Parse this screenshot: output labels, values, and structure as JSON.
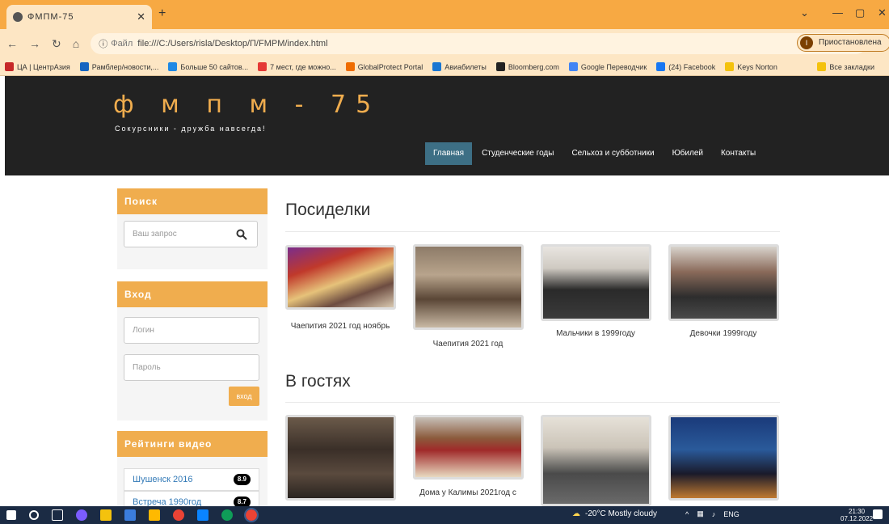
{
  "browser": {
    "tab_title": "ФМПМ-75",
    "url_label": "Файл",
    "url": "file:///C:/Users/risla/Desktop/П/FMPM/index.html",
    "profile_status": "Приостановлена",
    "profile_initial": "I",
    "bookmarks": [
      {
        "label": "ЦА | ЦентрАзия",
        "color": "#c62828"
      },
      {
        "label": "Рамблер/новости,...",
        "color": "#1565c0"
      },
      {
        "label": "Больше 50 сайтов...",
        "color": "#1e88e5"
      },
      {
        "label": "7 мест, где можно...",
        "color": "#e53935"
      },
      {
        "label": "GlobalProtect Portal",
        "color": "#ef6c00"
      },
      {
        "label": "Авиабилеты",
        "color": "#1976d2"
      },
      {
        "label": "Bloomberg.com",
        "color": "#222222"
      },
      {
        "label": "Google Переводчик",
        "color": "#4285f4"
      },
      {
        "label": "(24) Facebook",
        "color": "#1877f2"
      },
      {
        "label": "Keys Norton",
        "color": "#f4c20d"
      }
    ],
    "more_bookmarks": "Все закладки"
  },
  "site": {
    "logo": "ф м п м - 75",
    "slogan": "Сокурсники - дружба навсегда!",
    "menu": [
      "Главная",
      "Студенческие годы",
      "Сельхоз и субботники",
      "Юбилей",
      "Контакты"
    ]
  },
  "sidebar": {
    "search_title": "Поиск",
    "search_placeholder": "Ваш запрос",
    "login_title": "Вход",
    "login_placeholder": "Логин",
    "password_placeholder": "Пароль",
    "login_button": "вход",
    "ratings_title": "Рейтинги видео",
    "ratings": [
      {
        "title": "Шушенск 2016",
        "score": "8.9"
      },
      {
        "title": "Встреча 1990год",
        "score": "8.7"
      }
    ]
  },
  "main": {
    "section1_title": "Посиделки",
    "section1_items": [
      "Чаепития 2021 год ноябрь",
      "Чаепития 2021 год",
      "Мальчики в 1999году",
      "Девочки 1999году"
    ],
    "section2_title": "В гостях",
    "section2_items": [
      "Дома у Калимы 2021год с",
      "",
      "",
      ""
    ]
  },
  "taskbar": {
    "weather": "-20°C Mostly cloudy",
    "lang": "ENG",
    "time": "21:30",
    "date": "07.12.2022"
  }
}
